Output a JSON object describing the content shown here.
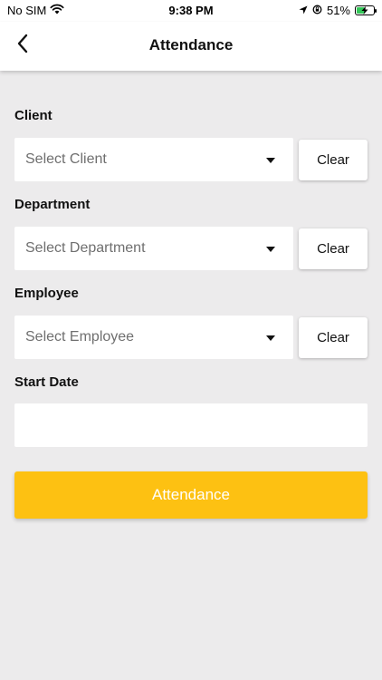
{
  "status_bar": {
    "carrier": "No SIM",
    "time": "9:38 PM",
    "battery_percent": "51%",
    "battery_level": 0.51,
    "icons": [
      "wifi-icon",
      "location-arrow-icon",
      "orientation-lock-icon",
      "battery-charging-icon"
    ]
  },
  "header": {
    "title": "Attendance",
    "back_icon": "chevron-left-icon"
  },
  "form": {
    "client": {
      "label": "Client",
      "placeholder": "Select Client",
      "clear_label": "Clear"
    },
    "department": {
      "label": "Department",
      "placeholder": "Select Department",
      "clear_label": "Clear"
    },
    "employee": {
      "label": "Employee",
      "placeholder": "Select Employee",
      "clear_label": "Clear"
    },
    "start_date": {
      "label": "Start Date",
      "value": ""
    },
    "submit_label": "Attendance"
  },
  "colors": {
    "background": "#ECEBEC",
    "accent": "#FDC112",
    "surface": "#FFFFFF"
  }
}
